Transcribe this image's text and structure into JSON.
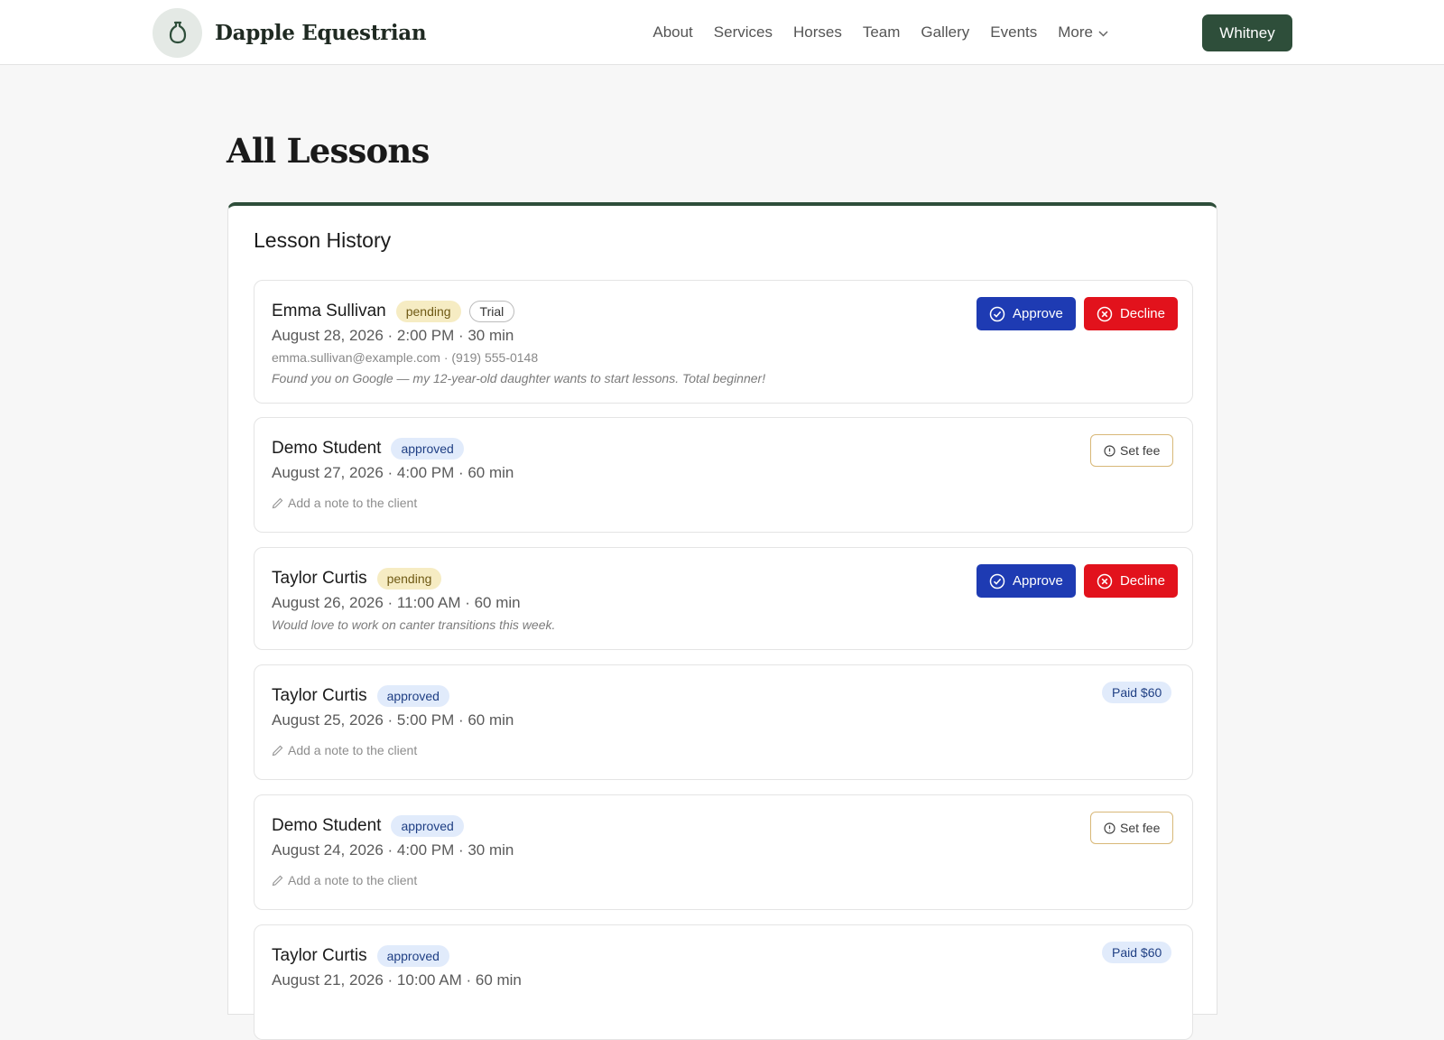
{
  "header": {
    "brand": "Dapple Equestrian",
    "nav": [
      "About",
      "Services",
      "Horses",
      "Team",
      "Gallery",
      "Events",
      "More"
    ],
    "user": "Whitney"
  },
  "page": {
    "title": "All Lessons",
    "section_title": "Lesson History"
  },
  "labels": {
    "approve": "Approve",
    "decline": "Decline",
    "set_fee": "Set fee",
    "add_note": "Add a note to the client"
  },
  "lessons": [
    {
      "student": "Emma Sullivan",
      "status": "pending",
      "tag": "Trial",
      "when": "August 28, 2026 · 2:00 PM · 30 min",
      "contact": "emma.sullivan@example.com · (919) 555-0148",
      "message": "Found you on Google — my 12-year-old daughter wants to start lessons. Total beginner!"
    },
    {
      "student": "Demo Student",
      "status": "approved",
      "when": "August 27, 2026 · 4:00 PM · 60 min"
    },
    {
      "student": "Taylor Curtis",
      "status": "pending",
      "when": "August 26, 2026 · 11:00 AM · 60 min",
      "message": "Would love to work on canter transitions this week."
    },
    {
      "student": "Taylor Curtis",
      "status": "approved",
      "when": "August 25, 2026 · 5:00 PM · 60 min",
      "paid": "Paid $60"
    },
    {
      "student": "Demo Student",
      "status": "approved",
      "when": "August 24, 2026 · 4:00 PM · 30 min"
    },
    {
      "student": "Taylor Curtis",
      "status": "approved",
      "when": "August 21, 2026 · 10:00 AM · 60 min",
      "paid": "Paid $60"
    }
  ],
  "colors": {
    "brand_green": "#2e4e3a",
    "approve_blue": "#1e3bb3",
    "decline_red": "#e2121c",
    "pending_badge": "#f6ecc3",
    "approved_badge": "#e1ebfb"
  },
  "icons": {
    "logo": "bottle-icon",
    "more": "chevron-down-icon",
    "approve": "check-circle-icon",
    "decline": "x-circle-icon",
    "set_fee": "info-circle-icon",
    "note": "pencil-icon"
  }
}
